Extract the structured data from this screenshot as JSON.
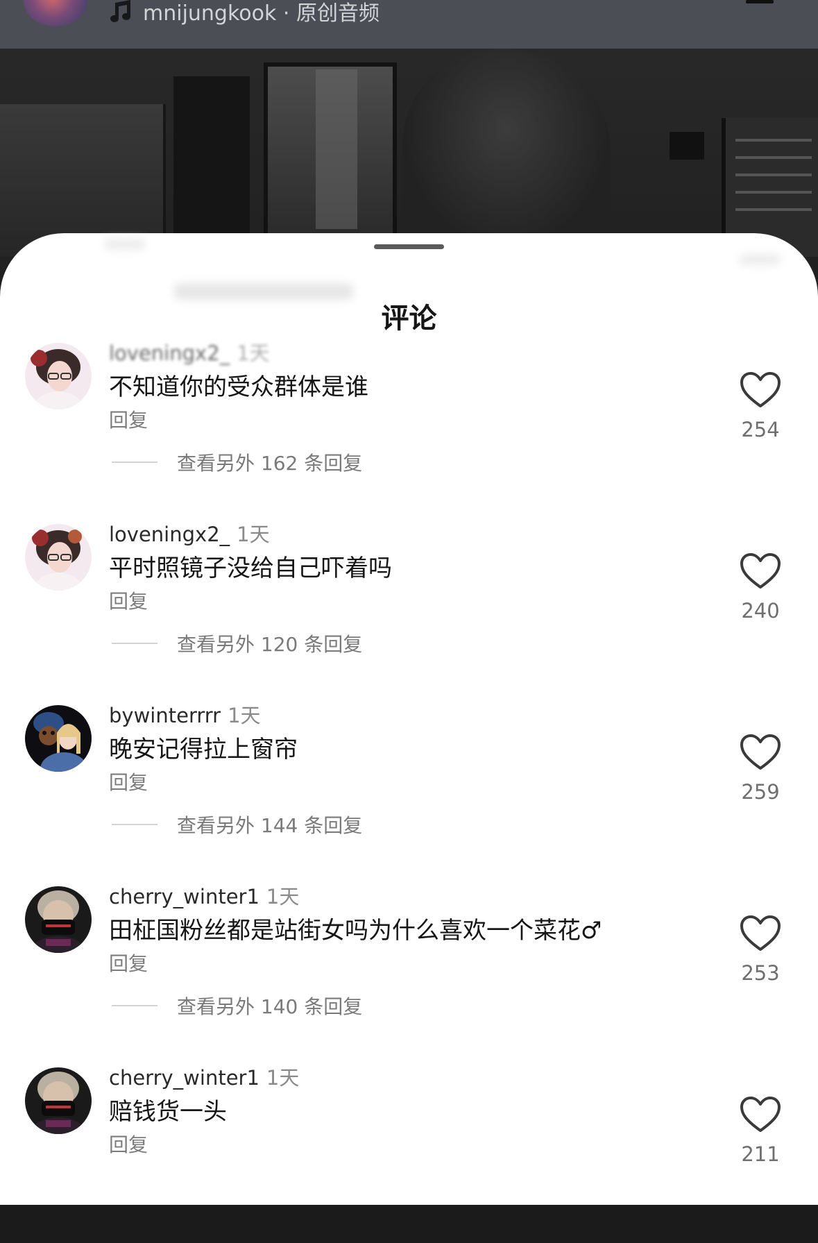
{
  "header": {
    "music_label": "mnijungkook · 原创音频"
  },
  "sheet": {
    "title": "评论"
  },
  "comments": [
    {
      "username": "loveningx2_",
      "time": "1天",
      "text": "不知道你的受众群体是谁",
      "reply_label": "回复",
      "more_replies": "查看另外 162 条回复",
      "likes": "254",
      "avatar_colors": [
        "#f3dfe6",
        "#8b3b3b"
      ]
    },
    {
      "username": "loveningx2_",
      "time": "1天",
      "text": "平时照镜子没给自己吓着吗",
      "reply_label": "回复",
      "more_replies": "查看另外 120 条回复",
      "likes": "240",
      "avatar_colors": [
        "#f3dfe6",
        "#8b3b3b"
      ]
    },
    {
      "username": "bywinterrrr",
      "time": "1天",
      "text": "晚安记得拉上窗帘",
      "reply_label": "回复",
      "more_replies": "查看另外 144 条回复",
      "likes": "259",
      "avatar_colors": [
        "#dce6f2",
        "#3a5a8a"
      ]
    },
    {
      "username": "cherry_winter1",
      "time": "1天",
      "text": "田柾国粉丝都是站街女吗为什么喜欢一个菜花♂",
      "reply_label": "回复",
      "more_replies": "查看另外 140 条回复",
      "likes": "253",
      "avatar_colors": [
        "#c9c2b8",
        "#151515"
      ]
    },
    {
      "username": "cherry_winter1",
      "time": "1天",
      "text": "赔钱货一头",
      "reply_label": "回复",
      "more_replies": "",
      "likes": "211",
      "avatar_colors": [
        "#c9c2b8",
        "#151515"
      ]
    }
  ]
}
